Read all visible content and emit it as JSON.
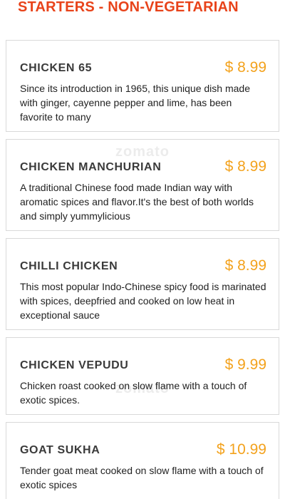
{
  "section": {
    "title": "STARTERS - NON-VEGETARIAN"
  },
  "watermark": "zomato",
  "colors": {
    "title": "#e8431a",
    "price": "#f3a21d",
    "name": "#3a3a3a",
    "border": "#d9d9d9"
  },
  "items": [
    {
      "name": "CHICKEN 65",
      "price": "$ 8.99",
      "description": "Since its introduction in 1965, this unique dish made with ginger, cayenne pepper and lime, has been favorite to many"
    },
    {
      "name": "CHICKEN MANCHURIAN",
      "price": "$ 8.99",
      "description": "A traditional Chinese food made Indian way with aromatic spices and flavor.It's the best of both worlds and simply yummylicious"
    },
    {
      "name": "CHILLI CHICKEN",
      "price": "$ 8.99",
      "description": "This most popular Indo-Chinese spicy food is marinated with spices, deepfried and cooked on low heat in exceptional sauce"
    },
    {
      "name": "CHICKEN VEPUDU",
      "price": "$ 9.99",
      "description": "Chicken roast cooked on slow flame with a touch of exotic spices."
    },
    {
      "name": "GOAT SUKHA",
      "price": "$ 10.99",
      "description": "Tender goat meat cooked on slow flame with a touch of exotic spices"
    }
  ]
}
